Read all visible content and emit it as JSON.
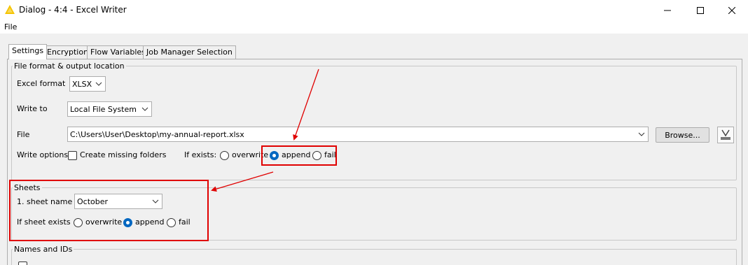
{
  "window": {
    "title": "Dialog - 4:4 - Excel Writer",
    "controls": [
      "minimize-icon",
      "maximize-icon",
      "close-icon"
    ]
  },
  "menu": {
    "file": "File"
  },
  "tabs": [
    {
      "label": "Settings",
      "active": true
    },
    {
      "label": "Encryption",
      "active": false
    },
    {
      "label": "Flow Variables",
      "active": false
    },
    {
      "label": "Job Manager Selection",
      "active": false
    }
  ],
  "file_group": {
    "title": "File format & output location",
    "excel_format_label": "Excel format",
    "excel_format_value": "XLSX",
    "write_to_label": "Write to",
    "write_to_value": "Local File System",
    "file_label": "File",
    "file_path": "C:\\Users\\User\\Desktop\\my-annual-report.xlsx",
    "browse_label": "Browse...",
    "write_options_label": "Write options",
    "create_missing_folders_label": "Create missing folders",
    "create_missing_folders_checked": false,
    "if_exists_label": "If exists:",
    "if_exists_options": [
      "overwrite",
      "append",
      "fail"
    ],
    "if_exists_selected": "append"
  },
  "sheets_group": {
    "title": "Sheets",
    "sheet_name_label": "1. sheet name",
    "sheet_name_value": "October",
    "if_sheet_exists_label": "If sheet exists",
    "if_sheet_exists_options": [
      "overwrite",
      "append",
      "fail"
    ],
    "if_sheet_exists_selected": "append"
  },
  "names_group": {
    "title": "Names and IDs"
  },
  "colors": {
    "accent": "#0067c0",
    "annotation": "#e00000",
    "warning_icon": "#f5c400"
  }
}
